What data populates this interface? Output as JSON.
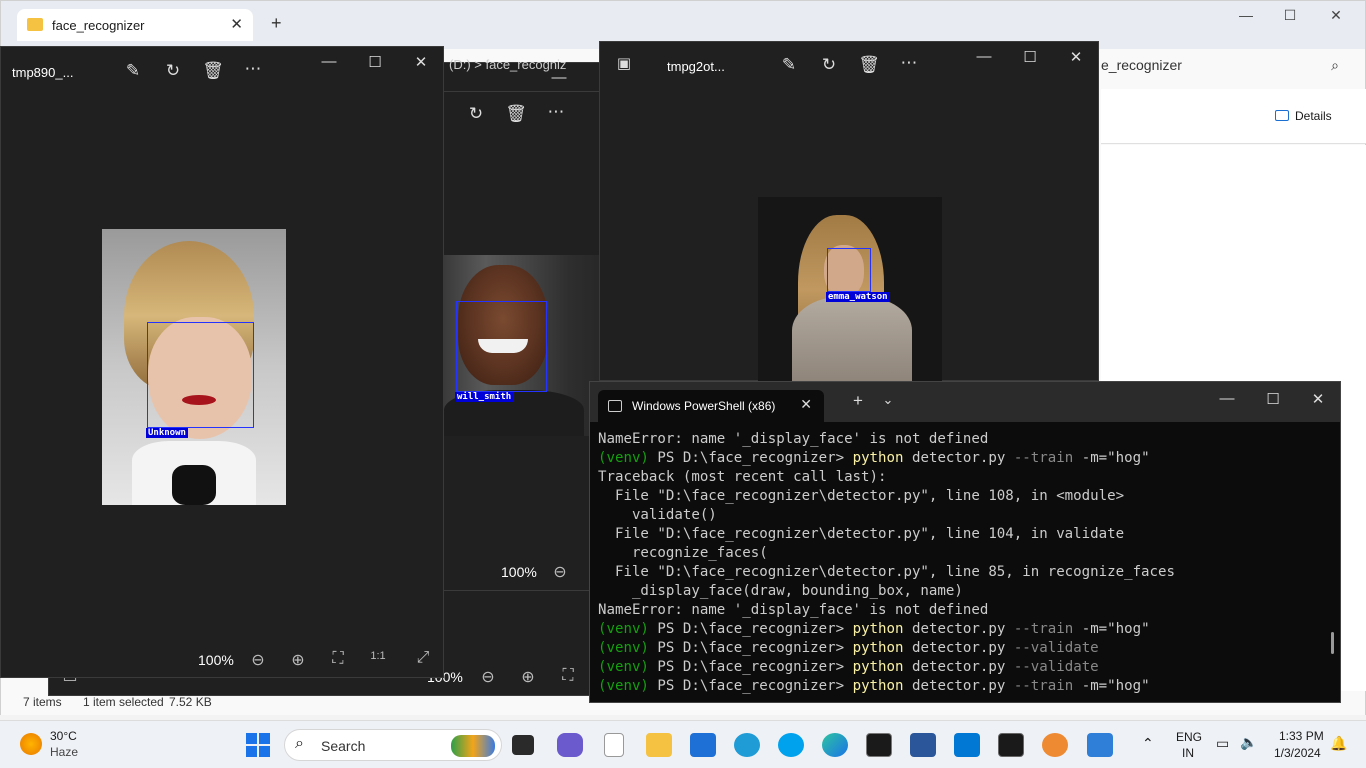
{
  "explorer": {
    "tab_title": "face_recognizer",
    "search_text": "e_recognizer",
    "details_label": "Details",
    "status_items": "7 items",
    "status_selected": "1 item selected",
    "status_size": "7.52 KB",
    "breadcrumb_partial": "(D:)  >  face_recogniz"
  },
  "photos_left": {
    "title": "tmp890_...",
    "zoom": "100%",
    "face_label": "Unknown"
  },
  "photos_middle": {
    "zoom": "100%",
    "face_label": "will_smith"
  },
  "photos_right": {
    "title": "tmpg2ot...",
    "face_label": "emma_watson"
  },
  "photos_back_zoom": "100%",
  "powershell": {
    "tab_title": "Windows PowerShell (x86)",
    "lines": [
      {
        "parts": [
          {
            "t": "NameError: name '_display_face' is not defined",
            "c": ""
          }
        ]
      },
      {
        "parts": [
          {
            "t": "(venv) ",
            "c": "g"
          },
          {
            "t": "PS D:\\face_recognizer> ",
            "c": ""
          },
          {
            "t": "python",
            "c": "y"
          },
          {
            "t": " detector.py ",
            "c": ""
          },
          {
            "t": "--train",
            "c": "d"
          },
          {
            "t": " -m=\"hog\"",
            "c": ""
          }
        ]
      },
      {
        "parts": [
          {
            "t": "Traceback (most recent call last):",
            "c": ""
          }
        ]
      },
      {
        "parts": [
          {
            "t": "  File \"D:\\face_recognizer\\detector.py\", line 108, in <module>",
            "c": ""
          }
        ]
      },
      {
        "parts": [
          {
            "t": "    validate()",
            "c": ""
          }
        ]
      },
      {
        "parts": [
          {
            "t": "  File \"D:\\face_recognizer\\detector.py\", line 104, in validate",
            "c": ""
          }
        ]
      },
      {
        "parts": [
          {
            "t": "    recognize_faces(",
            "c": ""
          }
        ]
      },
      {
        "parts": [
          {
            "t": "  File \"D:\\face_recognizer\\detector.py\", line 85, in recognize_faces",
            "c": ""
          }
        ]
      },
      {
        "parts": [
          {
            "t": "    _display_face(draw, bounding_box, name)",
            "c": ""
          }
        ]
      },
      {
        "parts": [
          {
            "t": "NameError: name '_display_face' is not defined",
            "c": ""
          }
        ]
      },
      {
        "parts": [
          {
            "t": "(venv) ",
            "c": "g"
          },
          {
            "t": "PS D:\\face_recognizer> ",
            "c": ""
          },
          {
            "t": "python",
            "c": "y"
          },
          {
            "t": " detector.py ",
            "c": ""
          },
          {
            "t": "--train",
            "c": "d"
          },
          {
            "t": " -m=\"hog\"",
            "c": ""
          }
        ]
      },
      {
        "parts": [
          {
            "t": "(venv) ",
            "c": "g"
          },
          {
            "t": "PS D:\\face_recognizer> ",
            "c": ""
          },
          {
            "t": "python",
            "c": "y"
          },
          {
            "t": " detector.py ",
            "c": ""
          },
          {
            "t": "--validate",
            "c": "d"
          }
        ]
      },
      {
        "parts": [
          {
            "t": "(venv) ",
            "c": "g"
          },
          {
            "t": "PS D:\\face_recognizer> ",
            "c": ""
          },
          {
            "t": "python",
            "c": "y"
          },
          {
            "t": " detector.py ",
            "c": ""
          },
          {
            "t": "--validate",
            "c": "d"
          }
        ]
      },
      {
        "parts": [
          {
            "t": "(venv) ",
            "c": "g"
          },
          {
            "t": "PS D:\\face_recognizer> ",
            "c": ""
          },
          {
            "t": "python",
            "c": "y"
          },
          {
            "t": " detector.py ",
            "c": ""
          },
          {
            "t": "--train",
            "c": "d"
          },
          {
            "t": " -m=\"hog\"",
            "c": ""
          }
        ]
      }
    ]
  },
  "taskbar": {
    "weather_temp": "30°C",
    "weather_desc": "Haze",
    "search_placeholder": "Search",
    "lang_top": "ENG",
    "lang_bottom": "IN",
    "time": "1:33 PM",
    "date": "1/3/2024"
  }
}
